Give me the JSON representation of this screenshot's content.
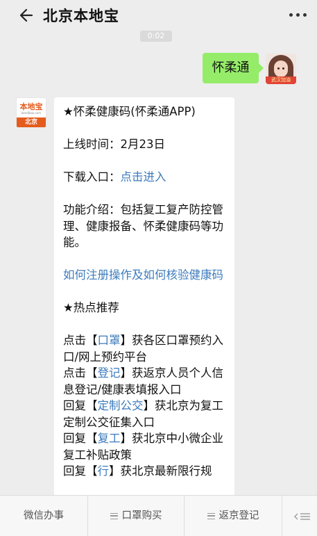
{
  "header": {
    "title": "北京本地宝",
    "back_icon": "back-arrow-icon",
    "more_icon": "more-dots-icon"
  },
  "conversation": {
    "timestamp": "0:02",
    "sent_message": "怀柔通",
    "user_avatar_banner": "武汉加油",
    "account_logo": {
      "top": "本地宝",
      "sub": "bendibao.com",
      "bottom": "北京"
    },
    "reply": {
      "line_app": "★怀柔健康码(怀柔通APP)",
      "line_online": "上线时间：2月23日",
      "download_prefix": "下载入口：",
      "download_link": "点击进入",
      "intro": "功能介绍：包括复工复产防控管理、健康报备、怀柔健康码等功能。",
      "register_link": "如何注册操作及如何核验健康码",
      "hot_title": "★热点推荐",
      "hot_items": [
        {
          "prefix": "点击【",
          "keyword": "口罩",
          "suffix": "】获各区口罩预约入口/网上预约平台"
        },
        {
          "prefix": "点击【",
          "keyword": "登记",
          "suffix": "】获返京人员个人信息登记/健康表填报入口"
        },
        {
          "prefix": "回复【",
          "keyword": "定制公交",
          "suffix": "】获北京为复工定制公交征集入口"
        },
        {
          "prefix": "回复【",
          "keyword": "复工",
          "suffix": "】获北京中小微企业复工补贴政策"
        },
        {
          "prefix": "回复【",
          "keyword": "行",
          "suffix": "】获北京最新限行规"
        }
      ]
    }
  },
  "bottom_menu": {
    "items": [
      {
        "label": "微信办事",
        "has_submenu": false
      },
      {
        "label": "口罩购买",
        "has_submenu": true
      },
      {
        "label": "返京登记",
        "has_submenu": true
      }
    ],
    "keyboard_icon": "keyboard-toggle-icon"
  }
}
